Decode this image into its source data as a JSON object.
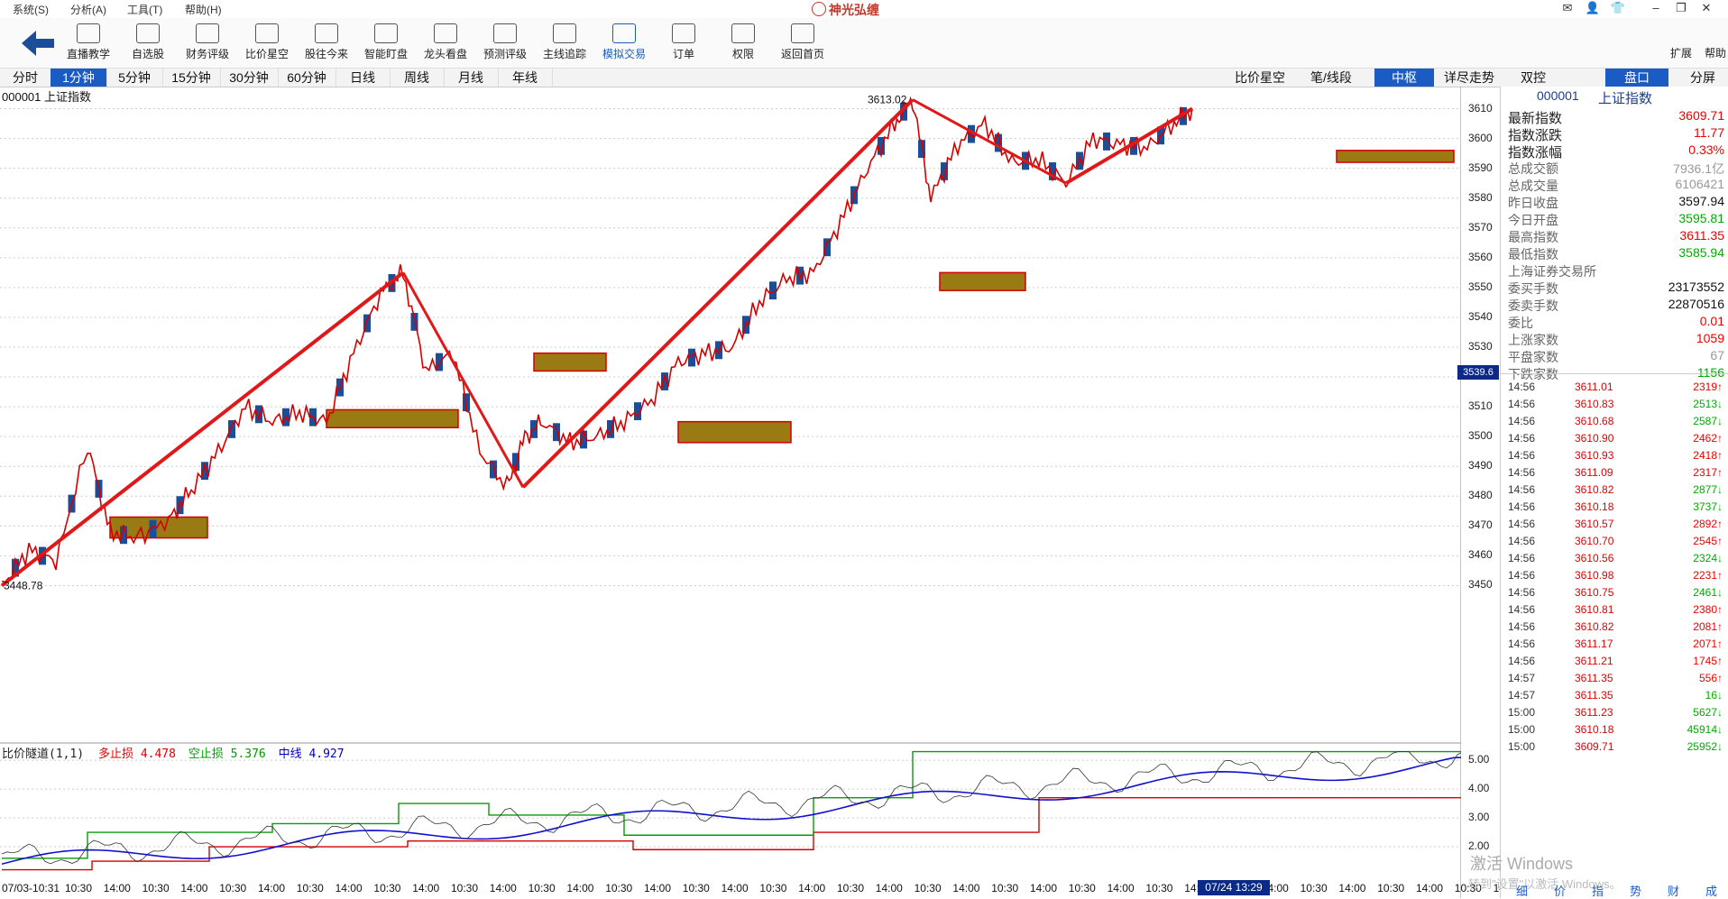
{
  "menu": [
    "系统(S)",
    "分析(A)",
    "工具(T)",
    "帮助(H)"
  ],
  "app_title": "神光弘缠",
  "toolbar": {
    "buttons": [
      "直播教学",
      "自选股",
      "财务评级",
      "比价星空",
      "股往今来",
      "智能盯盘",
      "龙头看盘",
      "预测评级",
      "主线追踪",
      "模拟交易",
      "订单",
      "权限",
      "返回首页"
    ],
    "active": "模拟交易",
    "side": [
      "扩展",
      "帮助"
    ]
  },
  "period_tabs": [
    "分时",
    "1分钟",
    "5分钟",
    "15分钟",
    "30分钟",
    "60分钟",
    "日线",
    "周线",
    "月线",
    "年线"
  ],
  "period_active": "1分钟",
  "right_tabs": [
    "比价星空",
    "笔/线段",
    "中枢",
    "详尽走势",
    "双控",
    "盘口",
    "分屏"
  ],
  "right_active": [
    "中枢",
    "盘口"
  ],
  "chart_label": "000001 上证指数",
  "indicator": {
    "name": "比价隧道(1,1)",
    "duo_label": "多止损",
    "duo_val": "4.478",
    "kong_label": "空止损",
    "kong_val": "5.376",
    "mid_label": "中线",
    "mid_val": "4.927"
  },
  "y_ticks": [
    "3610",
    "3600",
    "3590",
    "3580",
    "3570",
    "3560",
    "3550",
    "3540",
    "3530",
    "3520",
    "3510",
    "3500",
    "3490",
    "3480",
    "3470",
    "3460",
    "3450"
  ],
  "cur_price": "3539.6",
  "ind_ticks": [
    "5.00",
    "4.00",
    "3.00",
    "2.00"
  ],
  "x_ticks": [
    "07/03-10:31",
    "10:30",
    "14:00",
    "10:30",
    "14:00",
    "10:30",
    "14:00",
    "10:30",
    "14:00",
    "10:30",
    "14:00",
    "10:30",
    "14:00",
    "10:30",
    "14:00",
    "10:30",
    "14:00",
    "10:30",
    "14:00",
    "10:30",
    "14:00",
    "10:30",
    "14:00",
    "10:30",
    "14:00",
    "10:30",
    "14:00",
    "10:30",
    "14:00",
    "10:30",
    "14:00",
    "10:30",
    "14:00",
    "10:30",
    "14:00",
    "10:30",
    "14:00",
    "10:30",
    "14:"
  ],
  "x_highlight": "07/24 13:29",
  "price_annotations": {
    "high": "3613.02",
    "low": "3448.78"
  },
  "panel": {
    "code": "000001",
    "name": "上证指数",
    "rows": [
      {
        "k": "最新指数",
        "v": "3609.71",
        "c": "red"
      },
      {
        "k": "指数涨跌",
        "v": "11.77",
        "c": "red"
      },
      {
        "k": "指数涨幅",
        "v": "0.33%",
        "c": "red"
      },
      {
        "k": "总成交额",
        "v": "7936.1亿",
        "c": "gray"
      },
      {
        "k": "总成交量",
        "v": "6106421",
        "c": "gray"
      },
      {
        "k": "昨日收盘",
        "v": "3597.94",
        "c": "black"
      },
      {
        "k": "今日开盘",
        "v": "3595.81",
        "c": "green"
      },
      {
        "k": "最高指数",
        "v": "3611.35",
        "c": "red"
      },
      {
        "k": "最低指数",
        "v": "3585.94",
        "c": "green"
      },
      {
        "k": "上海证券交易所",
        "v": "",
        "c": "black"
      },
      {
        "k": "委买手数",
        "v": "23173552",
        "c": "black"
      },
      {
        "k": "委卖手数",
        "v": "22870516",
        "c": "black"
      },
      {
        "k": "委比",
        "v": "0.01",
        "c": "red"
      },
      {
        "k": "上涨家数",
        "v": "1059",
        "c": "red"
      },
      {
        "k": "平盘家数",
        "v": "67",
        "c": "gray"
      },
      {
        "k": "下跌家数",
        "v": "1156",
        "c": "green"
      }
    ],
    "ticks": [
      {
        "t": "14:56",
        "p": "3611.01",
        "v": "2319",
        "d": "up"
      },
      {
        "t": "14:56",
        "p": "3610.83",
        "v": "2513",
        "d": "down"
      },
      {
        "t": "14:56",
        "p": "3610.68",
        "v": "2587",
        "d": "down"
      },
      {
        "t": "14:56",
        "p": "3610.90",
        "v": "2462",
        "d": "up"
      },
      {
        "t": "14:56",
        "p": "3610.93",
        "v": "2418",
        "d": "up"
      },
      {
        "t": "14:56",
        "p": "3611.09",
        "v": "2317",
        "d": "up"
      },
      {
        "t": "14:56",
        "p": "3610.82",
        "v": "2877",
        "d": "down"
      },
      {
        "t": "14:56",
        "p": "3610.18",
        "v": "3737",
        "d": "down"
      },
      {
        "t": "14:56",
        "p": "3610.57",
        "v": "2892",
        "d": "up"
      },
      {
        "t": "14:56",
        "p": "3610.70",
        "v": "2545",
        "d": "up"
      },
      {
        "t": "14:56",
        "p": "3610.56",
        "v": "2324",
        "d": "down"
      },
      {
        "t": "14:56",
        "p": "3610.98",
        "v": "2231",
        "d": "up"
      },
      {
        "t": "14:56",
        "p": "3610.75",
        "v": "2461",
        "d": "down"
      },
      {
        "t": "14:56",
        "p": "3610.81",
        "v": "2380",
        "d": "up"
      },
      {
        "t": "14:56",
        "p": "3610.82",
        "v": "2081",
        "d": "up"
      },
      {
        "t": "14:56",
        "p": "3611.17",
        "v": "2071",
        "d": "up"
      },
      {
        "t": "14:56",
        "p": "3611.21",
        "v": "1745",
        "d": "up"
      },
      {
        "t": "14:57",
        "p": "3611.35",
        "v": "556",
        "d": "up"
      },
      {
        "t": "14:57",
        "p": "3611.35",
        "v": "16",
        "d": "down"
      },
      {
        "t": "15:00",
        "p": "3611.23",
        "v": "5627",
        "d": "down"
      },
      {
        "t": "15:00",
        "p": "3610.18",
        "v": "45914",
        "d": "down"
      },
      {
        "t": "15:00",
        "p": "3609.71",
        "v": "25952",
        "d": "down"
      }
    ],
    "bottom_tabs": [
      "细",
      "价",
      "指",
      "势",
      "财",
      "成"
    ]
  },
  "watermark": {
    "line1": "激活 Windows",
    "line2": "转到\"设置\"以激活 Windows。"
  },
  "chart_data": {
    "type": "line",
    "series": [
      {
        "name": "上证指数",
        "x": [
          0,
          30,
          60,
          95,
          120,
          150,
          185,
          210,
          240,
          270,
          300,
          330,
          360,
          390,
          420,
          445,
          470,
          500,
          530,
          560,
          580,
          600,
          630,
          660,
          690,
          720,
          750,
          780,
          810,
          840,
          870,
          900,
          930,
          960,
          990,
          1010,
          1030,
          1060,
          1090,
          1120,
          1150,
          1180,
          1210,
          1240,
          1270,
          1300,
          1320
        ],
        "values": [
          3450,
          3462,
          3458,
          3497,
          3468,
          3466,
          3472,
          3482,
          3495,
          3510,
          3505,
          3508,
          3505,
          3528,
          3548,
          3555,
          3522,
          3528,
          3495,
          3483,
          3500,
          3505,
          3498,
          3500,
          3505,
          3512,
          3525,
          3528,
          3530,
          3545,
          3553,
          3555,
          3572,
          3590,
          3605,
          3613,
          3580,
          3598,
          3605,
          3592,
          3593,
          3585,
          3600,
          3598,
          3597,
          3605,
          3610
        ]
      }
    ],
    "annotations": {
      "high": "3613.02",
      "low": "3448.78"
    },
    "ylim": [
      3445,
      3615
    ],
    "indicator_ylim": [
      1.0,
      5.6
    ]
  }
}
